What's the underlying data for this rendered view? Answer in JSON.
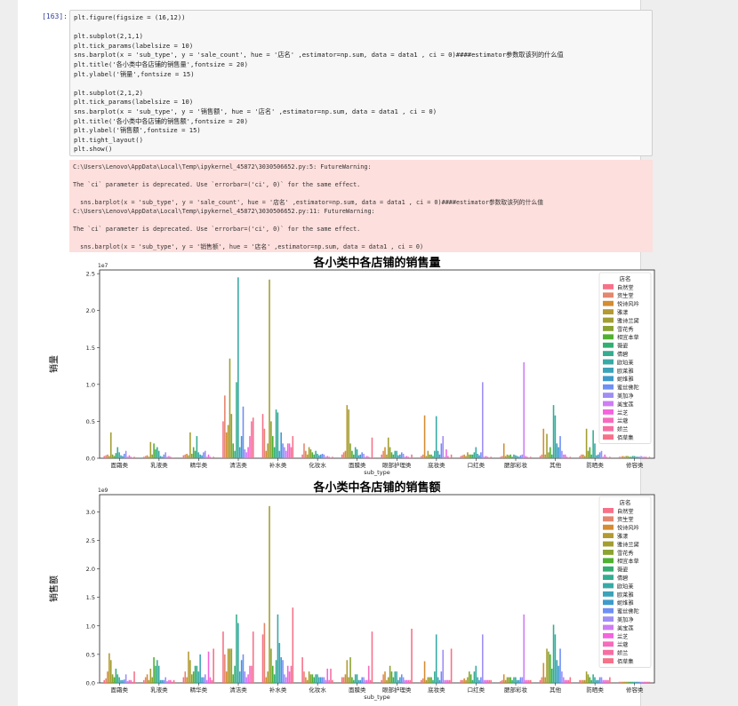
{
  "cell": {
    "prompt": "[163]:",
    "code_lines": [
      "plt.figure(figsize = (16,12))",
      "",
      "plt.subplot(2,1,1)",
      "plt.tick_params(labelsize = 10)",
      "sns.barplot(x = 'sub_type', y = 'sale_count', hue = '店名' ,estimator=np.sum, data = data1 , ci = 0)####estimator参数取该列的什么值",
      "plt.title('各小类中各店铺的销售量',fontsize = 20)",
      "plt.ylabel('销量',fontsize = 15)",
      "",
      "plt.subplot(2,1,2)",
      "plt.tick_params(labelsize = 10)",
      "sns.barplot(x = 'sub_type', y = '销售额', hue = '店名' ,estimator=np.sum, data = data1 , ci = 0)",
      "plt.title('各小类中各店铺的销售额',fontsize = 20)",
      "plt.ylabel('销售额',fontsize = 15)",
      "plt.tight_layout()",
      "plt.show()"
    ],
    "stderr_lines": [
      "C:\\Users\\Lenovo\\AppData\\Local\\Temp\\ipykernel_45872\\3030506652.py:5: FutureWarning:",
      "",
      "The `ci` parameter is deprecated. Use `errorbar=('ci', 0)` for the same effect.",
      "",
      "  sns.barplot(x = 'sub_type', y = 'sale_count', hue = '店名' ,estimator=np.sum, data = data1 , ci = 0)####estimator参数取该列的什么值",
      "C:\\Users\\Lenovo\\AppData\\Local\\Temp\\ipykernel_45872\\3030506652.py:11: FutureWarning:",
      "",
      "The `ci` parameter is deprecated. Use `errorbar=('ci', 0)` for the same effect.",
      "",
      "  sns.barplot(x = 'sub_type', y = '销售额', hue = '店名' ,estimator=np.sum, data = data1 , ci = 0)"
    ]
  },
  "colors": {
    "palette": [
      "#f77189",
      "#e5866e",
      "#d58c32",
      "#b39a31",
      "#a39e31",
      "#8ba331",
      "#50b131",
      "#34ae72",
      "#36ad91",
      "#38aaa6",
      "#3ba3b9",
      "#3d9bcc",
      "#6e8ff5",
      "#9f8ef5",
      "#ce7df5",
      "#f464dd",
      "#f66bbd",
      "#f76ea3"
    ]
  },
  "chart_data": [
    {
      "type": "bar",
      "title": "各小类中各店铺的销售量",
      "ylabel": "销量",
      "xlabel": "sub_type",
      "scale_label": "1e7",
      "ylim": [
        0,
        2.55
      ],
      "yticks": [
        "0.0",
        "0.5",
        "1.0",
        "1.5",
        "2.0",
        "2.5"
      ],
      "legend_title": "店名",
      "legend": [
        "自然堂",
        "资生堂",
        "悦诗风吟",
        "雅漾",
        "雅诗兰黛",
        "雪花秀",
        "相宜本草",
        "薇姿",
        "倩碧",
        "欧珀莱",
        "欧莱雅",
        "妮维雅",
        "蜜丝佛陀",
        "美加净",
        "美宝莲",
        "兰芝",
        "兰蔻",
        "娇兰",
        "佰草集"
      ],
      "categories": [
        "面霜类",
        "乳液类",
        "精华类",
        "清洁类",
        "补水类",
        "化妆水",
        "面膜类",
        "眼部护理类",
        "底妆类",
        "口红类",
        "腮部彩妆",
        "其他",
        "防晒类",
        "修容类"
      ],
      "values": [
        [
          0.03,
          0.04,
          0.05,
          0.03,
          0.35,
          0.05,
          0.03,
          0.07,
          0.15,
          0.08,
          0.04,
          0.03,
          0.06,
          0.1,
          0.02,
          0.04,
          0.02,
          0.01,
          0.02
        ],
        [
          0.02,
          0.03,
          0.04,
          0.02,
          0.22,
          0.05,
          0.2,
          0.12,
          0.15,
          0.1,
          0.03,
          0.02,
          0.05,
          0.08,
          0.02,
          0.03,
          0.02,
          0.01,
          0.01
        ],
        [
          0.04,
          0.05,
          0.06,
          0.04,
          0.35,
          0.06,
          0.15,
          0.1,
          0.3,
          0.08,
          0.05,
          0.04,
          0.08,
          0.1,
          0.02,
          0.05,
          0.02,
          0.01,
          0.02
        ],
        [
          0.5,
          0.85,
          0.35,
          0.45,
          1.35,
          0.6,
          0.2,
          0.1,
          1.03,
          2.45,
          0.15,
          0.3,
          0.7,
          0.12,
          0.08,
          0.15,
          0.3,
          0.5,
          0.55
        ],
        [
          0.6,
          0.4,
          0.1,
          0.2,
          2.42,
          0.5,
          0.3,
          0.15,
          0.66,
          0.62,
          0.1,
          0.35,
          0.2,
          0.15,
          0.1,
          0.2,
          0.2,
          0.15,
          0.3
        ],
        [
          0.05,
          0.2,
          0.1,
          0.05,
          0.15,
          0.12,
          0.08,
          0.05,
          0.1,
          0.06,
          0.04,
          0.05,
          0.06,
          0.05,
          0.02,
          0.03,
          0.02,
          0.01,
          0.02
        ],
        [
          0.05,
          0.08,
          0.1,
          0.72,
          0.66,
          0.2,
          0.1,
          0.05,
          0.15,
          0.12,
          0.04,
          0.05,
          0.08,
          0.06,
          0.02,
          0.03,
          0.02,
          0.01,
          0.28
        ],
        [
          0.05,
          0.1,
          0.15,
          0.05,
          0.28,
          0.15,
          0.08,
          0.05,
          0.1,
          0.1,
          0.04,
          0.05,
          0.08,
          0.06,
          0.02,
          0.03,
          0.02,
          0.01,
          0.05
        ],
        [
          0.03,
          0.05,
          0.58,
          0.03,
          0.1,
          0.05,
          0.05,
          0.03,
          0.1,
          0.57,
          0.1,
          0.05,
          0.2,
          0.3,
          0.02,
          0.12,
          0.03,
          0.01,
          0.05
        ],
        [
          0.03,
          0.04,
          0.05,
          0.03,
          0.08,
          0.05,
          0.05,
          0.05,
          0.08,
          0.15,
          0.06,
          0.04,
          0.08,
          1.03,
          0.02,
          0.03,
          0.02,
          0.01,
          0.02
        ],
        [
          0.02,
          0.03,
          0.2,
          0.03,
          0.05,
          0.04,
          0.05,
          0.02,
          0.05,
          0.04,
          0.03,
          0.02,
          0.04,
          0.05,
          1.3,
          0.03,
          0.02,
          0.01,
          0.02
        ],
        [
          0.03,
          0.05,
          0.4,
          0.05,
          0.33,
          0.08,
          0.15,
          0.05,
          0.72,
          0.58,
          0.2,
          0.15,
          0.3,
          0.1,
          0.05,
          0.05,
          0.02,
          0.01,
          0.02
        ],
        [
          0.03,
          0.05,
          0.05,
          0.03,
          0.4,
          0.1,
          0.15,
          0.05,
          0.38,
          0.2,
          0.04,
          0.05,
          0.08,
          0.1,
          0.02,
          0.05,
          0.02,
          0.01,
          0.02
        ],
        [
          0.02,
          0.02,
          0.03,
          0.02,
          0.03,
          0.03,
          0.02,
          0.02,
          0.03,
          0.03,
          0.02,
          0.02,
          0.02,
          0.03,
          0.02,
          0.02,
          0.02,
          0.01,
          0.02
        ]
      ]
    },
    {
      "type": "bar",
      "title": "各小类中各店铺的销售额",
      "ylabel": "销售额",
      "xlabel": "sub_type",
      "scale_label": "1e9",
      "ylim": [
        0,
        3.3
      ],
      "yticks": [
        "0.0",
        "0.5",
        "1.0",
        "1.5",
        "2.0",
        "2.5",
        "3.0"
      ],
      "legend_title": "店名",
      "legend": [
        "自然堂",
        "资生堂",
        "悦诗风吟",
        "雅漾",
        "雅诗兰黛",
        "雪花秀",
        "相宜本草",
        "薇姿",
        "倩碧",
        "欧珀莱",
        "欧莱雅",
        "妮维雅",
        "蜜丝佛陀",
        "美加净",
        "美宝莲",
        "兰芝",
        "兰蔻",
        "娇兰",
        "佰草集"
      ],
      "categories": [
        "面霜类",
        "乳液类",
        "精华类",
        "清洁类",
        "补水类",
        "化妆水",
        "面膜类",
        "眼部护理类",
        "底妆类",
        "口红类",
        "腮部彩妆",
        "其他",
        "防晒类",
        "修容类"
      ],
      "values": [
        [
          0.05,
          0.08,
          0.2,
          0.52,
          0.4,
          0.15,
          0.1,
          0.25,
          0.15,
          0.1,
          0.05,
          0.05,
          0.06,
          0.15,
          0.03,
          0.05,
          0.05,
          0.02,
          0.2
        ],
        [
          0.05,
          0.1,
          0.15,
          0.05,
          0.25,
          0.1,
          0.45,
          0.3,
          0.4,
          0.3,
          0.05,
          0.05,
          0.05,
          0.1,
          0.03,
          0.05,
          0.05,
          0.02,
          0.05
        ],
        [
          0.1,
          0.2,
          0.1,
          0.55,
          0.4,
          0.15,
          0.2,
          0.3,
          0.3,
          0.2,
          0.5,
          0.1,
          0.1,
          0.15,
          0.05,
          0.55,
          0.1,
          0.05,
          0.6
        ],
        [
          0.9,
          0.5,
          0.2,
          0.6,
          0.6,
          0.6,
          0.15,
          0.3,
          1.2,
          1.05,
          0.2,
          0.4,
          0.5,
          0.2,
          0.1,
          0.15,
          0.3,
          0.3,
          0.9
        ],
        [
          0.85,
          1.05,
          0.1,
          0.2,
          3.1,
          0.6,
          0.3,
          0.15,
          0.4,
          1.2,
          0.7,
          0.45,
          0.4,
          0.15,
          0.1,
          0.3,
          0.2,
          0.3,
          1.32
        ],
        [
          0.45,
          0.2,
          0.1,
          0.05,
          0.2,
          0.15,
          0.15,
          0.1,
          0.15,
          0.15,
          0.1,
          0.1,
          0.1,
          0.1,
          0.05,
          0.25,
          0.05,
          0.25,
          0.05
        ],
        [
          0.1,
          0.1,
          0.15,
          0.4,
          0.1,
          0.45,
          0.1,
          0.05,
          0.15,
          0.15,
          0.05,
          0.05,
          0.1,
          0.1,
          0.05,
          0.05,
          0.3,
          0.05,
          0.9
        ],
        [
          0.05,
          0.15,
          0.2,
          0.05,
          0.1,
          0.3,
          0.2,
          0.1,
          0.2,
          0.2,
          0.05,
          0.1,
          0.15,
          0.1,
          0.05,
          0.05,
          0.05,
          0.05,
          0.95
        ],
        [
          0.05,
          0.08,
          0.38,
          0.05,
          0.1,
          0.1,
          0.1,
          0.05,
          0.2,
          0.85,
          0.1,
          0.05,
          0.2,
          0.58,
          0.05,
          0.05,
          0.05,
          0.05,
          0.6
        ],
        [
          0.05,
          0.05,
          0.08,
          0.05,
          0.1,
          0.2,
          0.15,
          0.05,
          0.2,
          0.3,
          0.1,
          0.05,
          0.1,
          0.85,
          0.05,
          0.05,
          0.05,
          0.05,
          0.05
        ],
        [
          0.03,
          0.05,
          0.15,
          0.05,
          0.1,
          0.1,
          0.1,
          0.05,
          0.1,
          0.1,
          0.05,
          0.05,
          0.1,
          0.1,
          1.2,
          0.05,
          0.05,
          0.05,
          0.05
        ],
        [
          0.05,
          0.1,
          0.35,
          0.1,
          0.6,
          0.55,
          0.5,
          0.25,
          1.02,
          0.85,
          0.4,
          0.3,
          0.6,
          0.2,
          0.1,
          0.05,
          0.05,
          0.05,
          0.1
        ],
        [
          0.05,
          0.05,
          0.05,
          0.05,
          0.2,
          0.15,
          0.1,
          0.05,
          0.15,
          0.1,
          0.05,
          0.05,
          0.1,
          0.1,
          0.05,
          0.05,
          0.05,
          0.05,
          0.1
        ],
        [
          0.02,
          0.02,
          0.02,
          0.02,
          0.02,
          0.02,
          0.02,
          0.02,
          0.02,
          0.02,
          0.02,
          0.02,
          0.02,
          0.02,
          0.02,
          0.02,
          0.02,
          0.02,
          0.02
        ]
      ]
    }
  ]
}
